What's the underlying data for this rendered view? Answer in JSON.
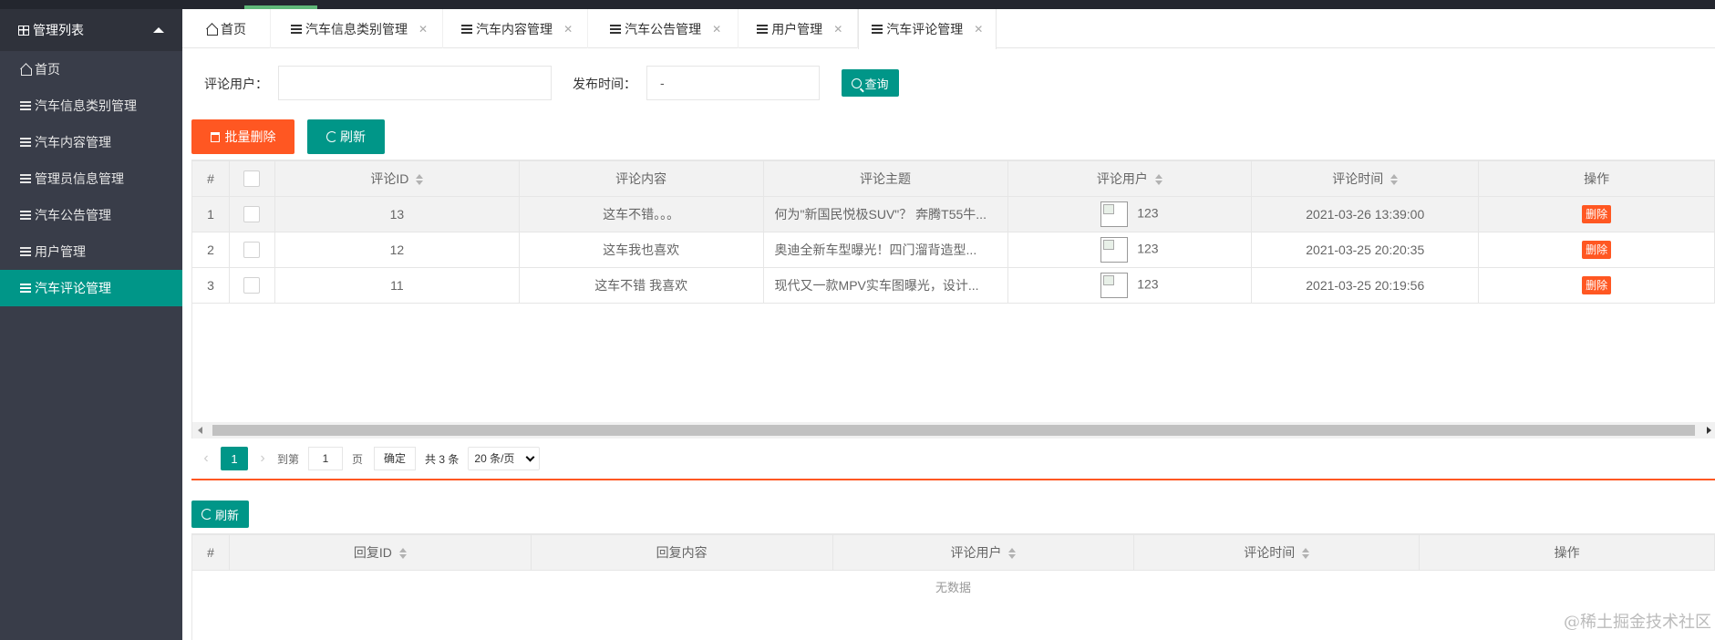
{
  "sidebar": {
    "title": "管理列表",
    "items": [
      {
        "label": "首页",
        "icon": "home-icon"
      },
      {
        "label": "汽车信息类别管理",
        "icon": "list-icon"
      },
      {
        "label": "汽车内容管理",
        "icon": "list-icon"
      },
      {
        "label": "管理员信息管理",
        "icon": "list-icon"
      },
      {
        "label": "汽车公告管理",
        "icon": "list-icon"
      },
      {
        "label": "用户管理",
        "icon": "list-icon"
      },
      {
        "label": "汽车评论管理",
        "icon": "list-icon",
        "active": true
      }
    ]
  },
  "tabs": [
    {
      "label": "首页"
    },
    {
      "label": "汽车信息类别管理"
    },
    {
      "label": "汽车内容管理"
    },
    {
      "label": "汽车公告管理"
    },
    {
      "label": "用户管理"
    },
    {
      "label": "汽车评论管理",
      "active": true
    }
  ],
  "search": {
    "user_label": "评论用户：",
    "user_value": "",
    "time_label": "发布时间：",
    "time_value": "-",
    "query_button": "查询"
  },
  "toolbar": {
    "batch_delete": "批量删除",
    "refresh": "刷新"
  },
  "comments_table": {
    "headers": {
      "index": "#",
      "id": "评论ID",
      "content": "评论内容",
      "subject": "评论主题",
      "user": "评论用户",
      "time": "评论时间",
      "action": "操作"
    },
    "rows": [
      {
        "index": "1",
        "id": "13",
        "content": "这车不错。。。",
        "subject": "何为\"新国民悦极SUV\"？ 奔腾T55牛...",
        "user": "123",
        "time": "2021-03-26 13:39:00",
        "action": "删除"
      },
      {
        "index": "2",
        "id": "12",
        "content": "这车我也喜欢",
        "subject": "奥迪全新车型曝光！四门溜背造型...",
        "user": "123",
        "time": "2021-03-25 20:20:35",
        "action": "删除"
      },
      {
        "index": "3",
        "id": "11",
        "content": "这车不错  我喜欢",
        "subject": "现代又一款MPV实车图曝光，设计...",
        "user": "123",
        "time": "2021-03-25 20:19:56",
        "action": "删除"
      }
    ]
  },
  "pager": {
    "current_page": "1",
    "goto_label": "到第",
    "goto_value": "1",
    "page_unit": "页",
    "confirm": "确定",
    "total": "共 3 条",
    "page_size": "20 条/页"
  },
  "reply_toolbar": {
    "refresh": "刷新"
  },
  "reply_table": {
    "headers": {
      "index": "#",
      "id": "回复ID",
      "content": "回复内容",
      "user": "评论用户",
      "time": "评论时间",
      "action": "操作"
    },
    "empty": "无数据"
  },
  "watermark": "@稀土掘金技术社区",
  "colors": {
    "sidebar_bg": "#393d49",
    "active_teal": "#009688",
    "danger_orange": "#ff5722"
  }
}
